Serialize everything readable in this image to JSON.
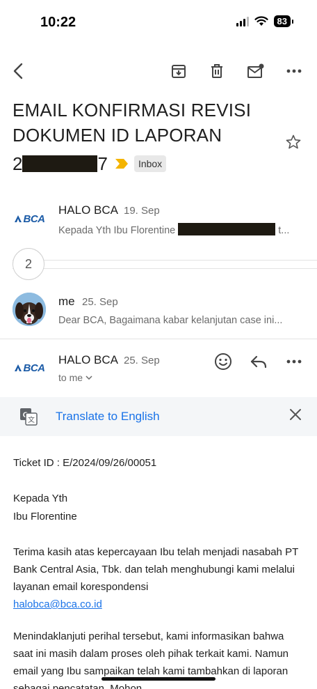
{
  "status_bar": {
    "time": "10:22",
    "battery": "83"
  },
  "email": {
    "subject_line1": "EMAIL KONFIRMASI REVISI",
    "subject_line2": "DOKUMEN ID LAPORAN",
    "subject_num_start": "2",
    "subject_num_end": "7",
    "label": "Inbox"
  },
  "thread": [
    {
      "sender": "HALO BCA",
      "date": "19. Sep",
      "snippet_prefix": "Kepada Yth Ibu Florentine",
      "snippet_suffix": "t...",
      "avatar": "BCA"
    },
    {
      "collapsed_count": "2"
    },
    {
      "sender": "me",
      "date": "25. Sep",
      "snippet": "Dear BCA, Bagaimana kabar kelanjutan case ini..."
    },
    {
      "sender": "HALO BCA",
      "date": "25. Sep",
      "recipient": "to me",
      "avatar": "BCA"
    }
  ],
  "translate": {
    "link": "Translate to English"
  },
  "body": {
    "ticket": "Ticket ID : E/2024/09/26/00051",
    "greeting1": "Kepada Yth",
    "greeting2": "Ibu Florentine",
    "para1": "Terima kasih atas kepercayaan Ibu telah menjadi nasabah PT Bank Central Asia, Tbk. dan telah menghubungi kami melalui layanan email korespondensi",
    "email_link": "halobca@bca.co.id",
    "para2": "Menindaklanjuti perihal tersebut, kami informasikan bahwa saat ini masih dalam proses oleh pihak terkait kami. Namun email yang Ibu sampaikan telah kami tambahkan di laporan sebagai pencatatan. Mohon"
  },
  "colors": {
    "accent": "#1a73e8",
    "bca_blue": "#1a5aa6",
    "important_marker": "#f4b400"
  }
}
